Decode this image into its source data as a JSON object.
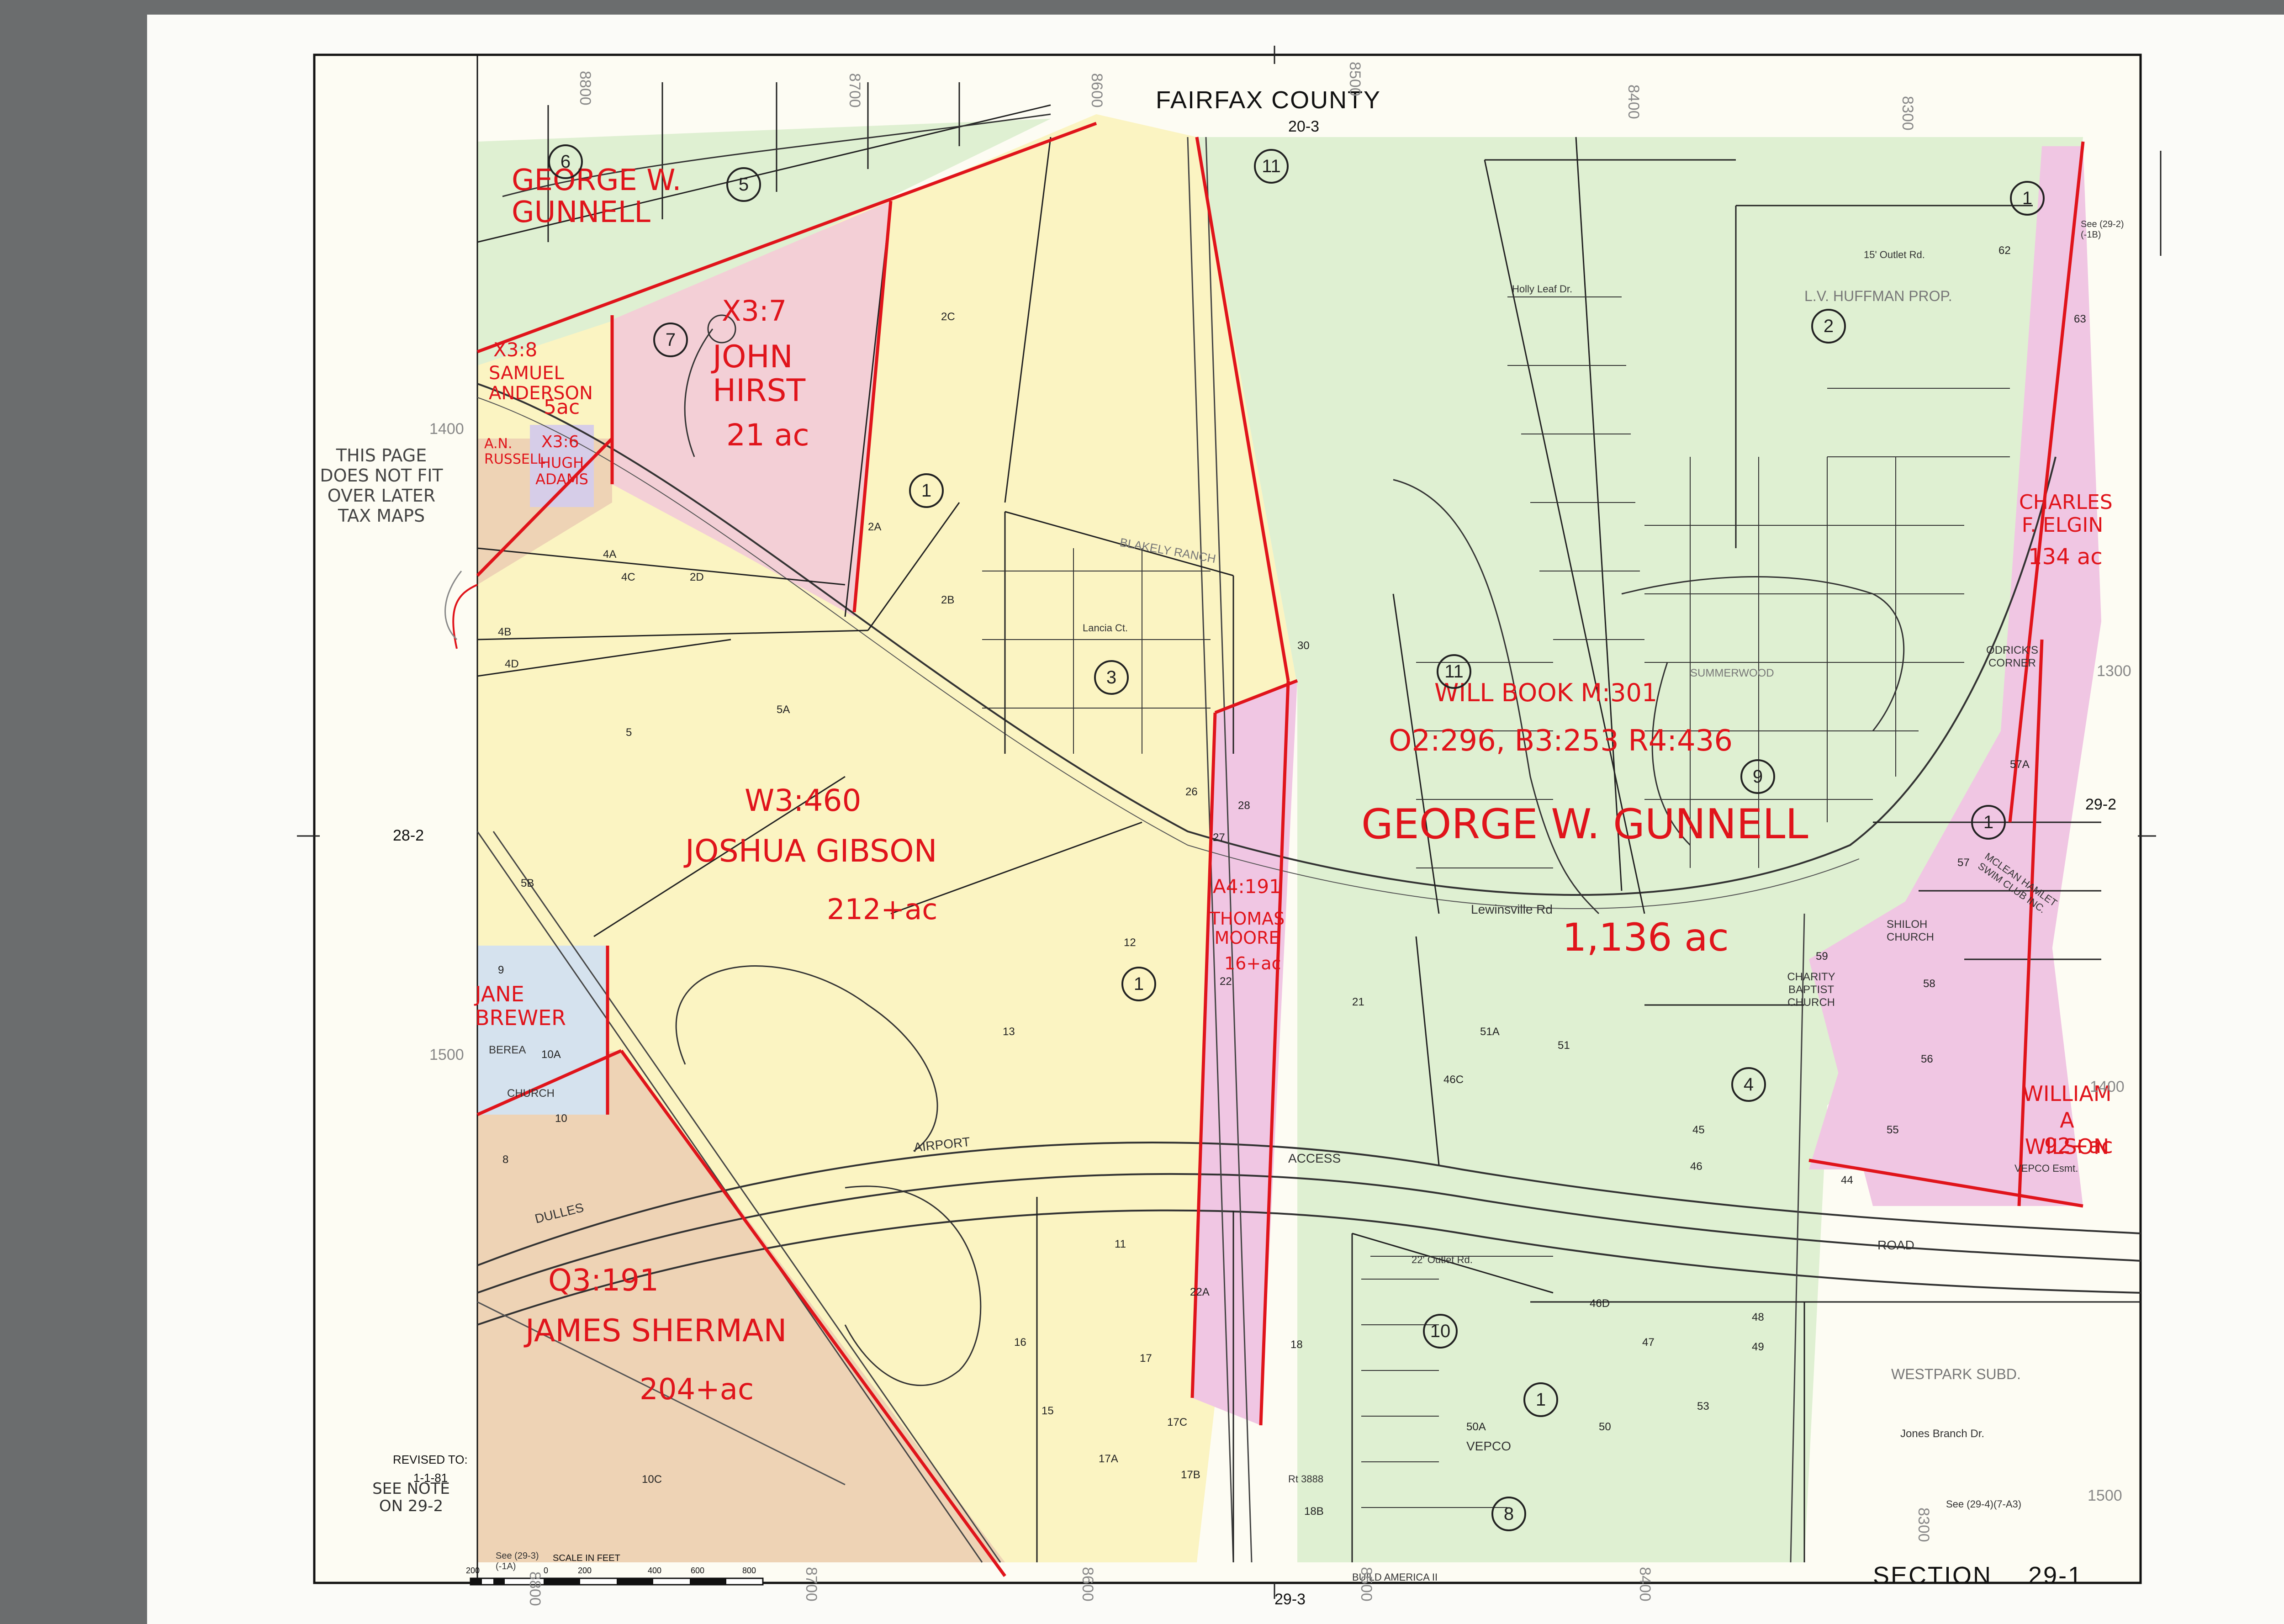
{
  "header": {
    "county": "FAIRFAX     COUNTY",
    "top_grid": "20-3",
    "bottom_grid": "29-3",
    "left_grid": "28-2",
    "right_grid": "29-2",
    "section_label": "SECTION",
    "section_number": "29-1"
  },
  "revision": {
    "revised_to": "REVISED  TO:",
    "date": "1-1-81",
    "note": "SEE NOTE ON 29-2"
  },
  "scale_bar": {
    "title": "SCALE   IN   FEET",
    "ticks": [
      "200",
      "0",
      "200",
      "400",
      "600",
      "800"
    ]
  },
  "margin_note": "THIS PAGE DOES NOT FIT OVER LATER TAX MAPS",
  "annotations": {
    "gunnell_nw": "GEORGE W. GUNNELL",
    "hirst_ref": "X3:7",
    "hirst_name": "JOHN HIRST",
    "hirst_area": "21 ac",
    "anderson_ref": "X3:8",
    "anderson_name": "SAMUEL ANDERSON",
    "anderson_area": "5ac",
    "russell": "A.N. RUSSELL",
    "adams_ref": "X3:6",
    "adams_name": "HUGH ADAMS",
    "gibson_ref": "W3:460",
    "gibson_name": "JOSHUA GIBSON",
    "gibson_area": "212+ac",
    "moore_ref": "A4:191",
    "moore_name": "THOMAS MOORE",
    "moore_area": "16+ac",
    "will_book": "WILL BOOK M:301",
    "gunnell_refs": "O2:296, B3:253  R4:436",
    "gunnell_name": "GEORGE W. GUNNELL",
    "gunnell_area": "1,136 ac",
    "elgin_name": "CHARLES F. ELGIN",
    "elgin_area": "134 ac",
    "brewer": "JANE BREWER",
    "wilson_name": "WILLIAM A WILSON",
    "wilson_area": "92+ac",
    "sherman_ref": "Q3:191",
    "sherman_name": "JAMES SHERMAN",
    "sherman_area": "204+ac"
  },
  "map_labels": {
    "airport": "AIRPORT",
    "access": "ACCESS",
    "road": "ROAD",
    "dulles": "DULLES",
    "lewinsville_rd": "Lewinsville          Rd",
    "huffman": "L.V. HUFFMAN  PROP.",
    "westpark": "WESTPARK  SUBD.",
    "odricks": "ODRICK'S CORNER",
    "charity": "CHARITY BAPTIST CHURCH",
    "shiloh": "SHILOH CHURCH",
    "mclean": "MCLEAN HAMLET SWIM CLUB INC.",
    "vepco": "VEPCO",
    "vepco_esmt": "VEPCO  Esmt.",
    "berea": "BEREA",
    "church": "CHURCH",
    "blakely": "BLAKELY RANCH",
    "jones_branch": "Jones  Branch  Dr.",
    "summerwood": "SUMMERWOOD",
    "outlet_15": "15' Outlet Rd.",
    "outlet_22": "22' Outlet Rd.",
    "holly_leaf": "Holly   Leaf   Dr.",
    "lancia": "Lancia   Ct.",
    "see_top_right": "See (29-2)(-1B)",
    "see_bottom_right": "See (29-4)(7-A3)",
    "see_bottom_left": "See (29-3)(-1A)",
    "build_america": "BUILD AMERICA II",
    "rt_3888": "Rt 3888"
  },
  "block_circles": [
    "6",
    "5",
    "7",
    "1",
    "3",
    "11",
    "1",
    "2",
    "11",
    "9",
    "1",
    "1",
    "4",
    "10",
    "1",
    "8"
  ],
  "parcels": [
    "2C",
    "2A",
    "2B",
    "4A",
    "4C",
    "2D",
    "4B",
    "4D",
    "5",
    "5A",
    "5B",
    "13",
    "12",
    "16",
    "15",
    "17",
    "17A",
    "17B",
    "17C",
    "22",
    "22A",
    "21",
    "51",
    "51A",
    "46C",
    "30",
    "28",
    "26",
    "27",
    "55",
    "56",
    "57",
    "57A",
    "58",
    "59",
    "44",
    "45",
    "46",
    "46D",
    "47",
    "48",
    "49",
    "50",
    "50A",
    "53",
    "10",
    "10A",
    "10C",
    "8",
    "9",
    "62",
    "63",
    "18",
    "18B",
    "11"
  ],
  "colors": {
    "yellow": "#fbf4c2",
    "green": "#dff0d2",
    "pink": "#f0c6e3",
    "orange": "#eed3b5",
    "blue": "#d5e2ee",
    "red": "#e0141b"
  }
}
